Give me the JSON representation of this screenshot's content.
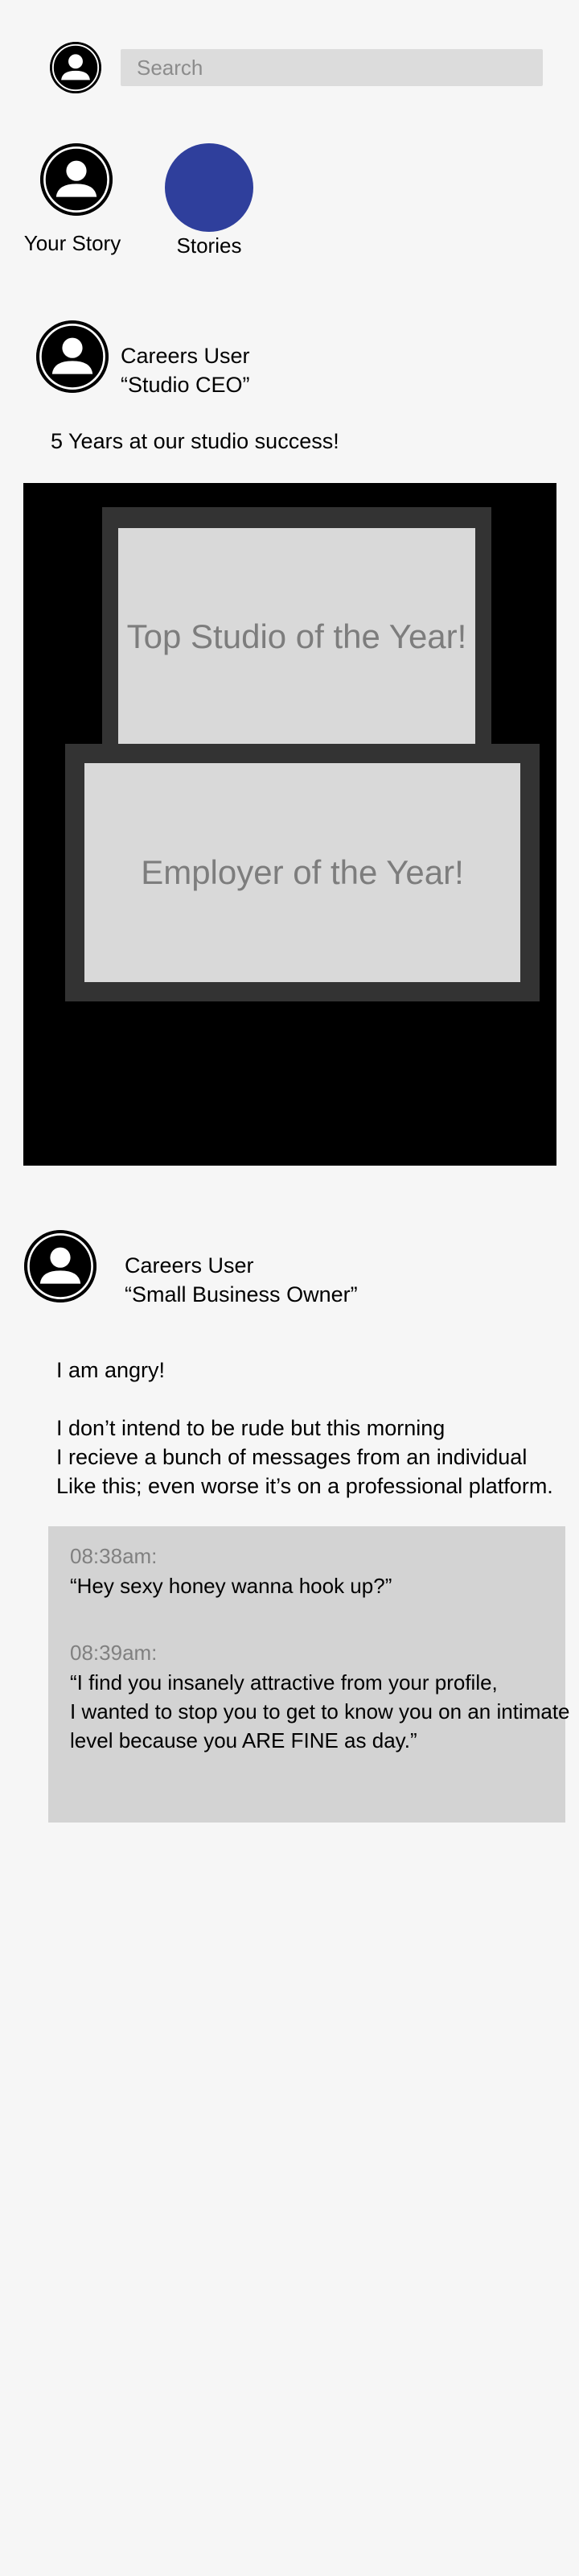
{
  "header": {
    "search_placeholder": "Search"
  },
  "stories": {
    "your_story_label": "Your Story",
    "stories_label": "Stories",
    "stories_color": "#2f3f9c"
  },
  "posts": [
    {
      "user_name": "Careers User",
      "user_title": "“Studio CEO”",
      "text": "5 Years at our studio success!",
      "image": {
        "award_top": "Top Studio of the Year!",
        "award_bottom": "Employer of the Year!"
      }
    },
    {
      "user_name": "Careers User",
      "user_title": "“Small Business Owner”",
      "intro": "I am angry!",
      "body_lines": [
        "I don’t intend to be rude but this morning",
        "I recieve a bunch of messages from an individual",
        "Like this; even worse it’s on a professional platform."
      ],
      "messages": [
        {
          "time": "08:38am:",
          "lines": [
            "“Hey sexy honey wanna hook up?”"
          ]
        },
        {
          "time": "08:39am:",
          "lines": [
            "“I find you insanely attractive from your profile,",
            "I wanted to stop you to get to know you on an intimate",
            "level because you ARE FINE as day.”"
          ]
        }
      ]
    }
  ]
}
